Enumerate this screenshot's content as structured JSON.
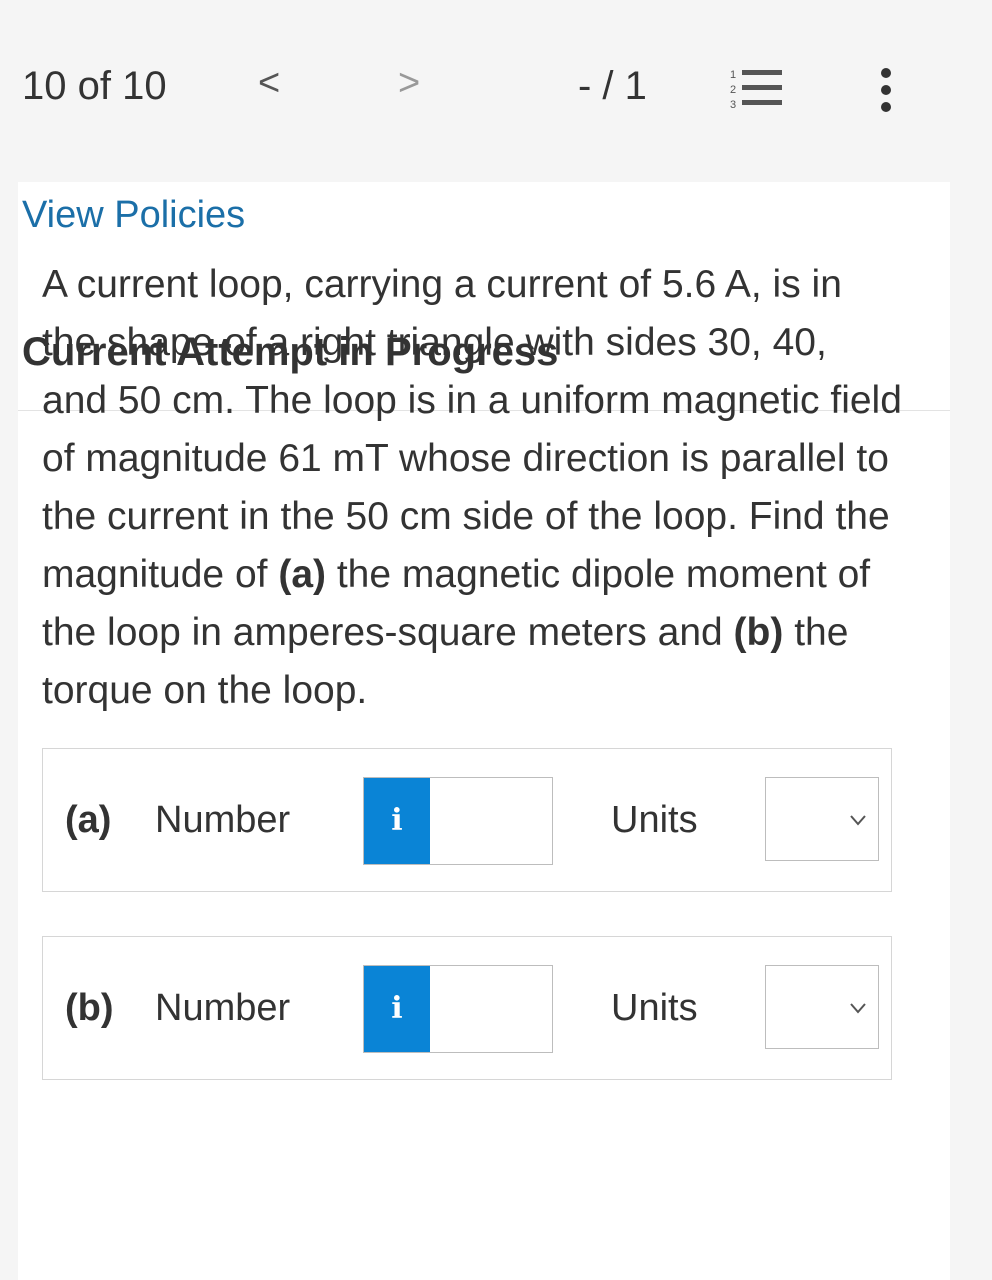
{
  "header": {
    "counter": "10 of 10",
    "prev_label": "<",
    "next_label": ">",
    "score": "- / 1"
  },
  "card": {
    "policies_link": "View Policies",
    "attempt_heading": "Current Attempt in Progress"
  },
  "question": {
    "text_1": "A current loop, carrying a current of 5.6 A, is in the shape of a right triangle with sides 30, 40, and 50 cm. The loop is in a uniform magnetic field of magnitude 61 mT whose direction is parallel to the current in the 50 cm side of the loop. Find the magnitude of ",
    "part_a_ref": "(a)",
    "text_2": " the magnetic dipole moment of the loop in amperes-square meters and ",
    "part_b_ref": "(b)",
    "text_3": " the torque on the loop."
  },
  "answers": {
    "a": {
      "part": "(a)",
      "number_label": "Number",
      "info": "i",
      "value": "",
      "units_label": "Units",
      "units_value": ""
    },
    "b": {
      "part": "(b)",
      "number_label": "Number",
      "info": "i",
      "value": "",
      "units_label": "Units",
      "units_value": ""
    }
  },
  "colors": {
    "accent": "#0a84d6",
    "link": "#1b6fa8",
    "background": "#f5f5f5"
  }
}
